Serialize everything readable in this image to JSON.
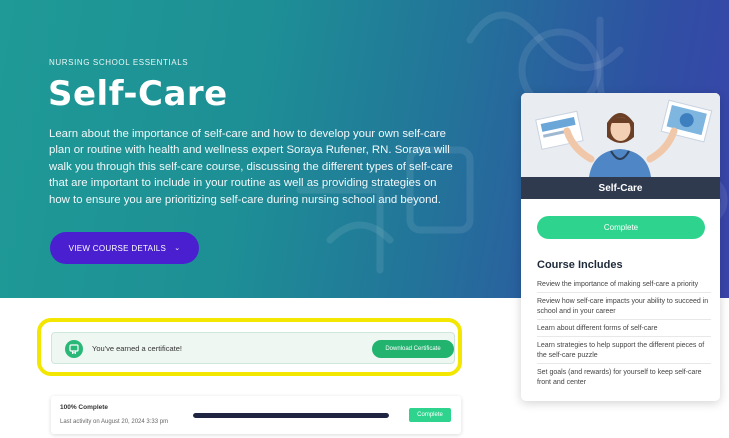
{
  "hero": {
    "eyebrow": "NURSING SCHOOL ESSENTIALS",
    "title": "Self-Care",
    "description": "Learn about the importance of self-care and how to develop your own self-care plan or routine with health and wellness expert Soraya Rufener, RN. Soraya will walk you through this self-care course, discussing the different types of self-care that are important to include in your routine as well as providing strategies on how to ensure you are prioritizing self-care during nursing school and beyond.",
    "view_button_label": "VIEW COURSE DETAILS",
    "view_button_icon": "chevron-down-icon"
  },
  "card": {
    "title": "Self-Care",
    "complete_label": "Complete",
    "includes_title": "Course Includes",
    "includes": [
      "Review the importance of making self-care a priority",
      "Review how self-care impacts your ability to succeed in school and in your career",
      "Learn about different forms of self-care",
      "Learn strategies to help support the different pieces of the self-care puzzle",
      "Set goals (and rewards) for yourself to keep self-care front and center"
    ]
  },
  "certificate": {
    "icon": "certificate-icon",
    "message": "You've earned a certificate!",
    "download_label": "Download Certificate"
  },
  "progress": {
    "percent_label": "100% Complete",
    "percent": 100,
    "last_activity": "Last activity on August 20, 2024 3:33 pm",
    "status_label": "Complete"
  },
  "colors": {
    "accent_green": "#2ed48d",
    "button_purple": "#4a1fd0",
    "highlight_yellow": "#f3e600",
    "card_band": "#2f3a4f"
  }
}
